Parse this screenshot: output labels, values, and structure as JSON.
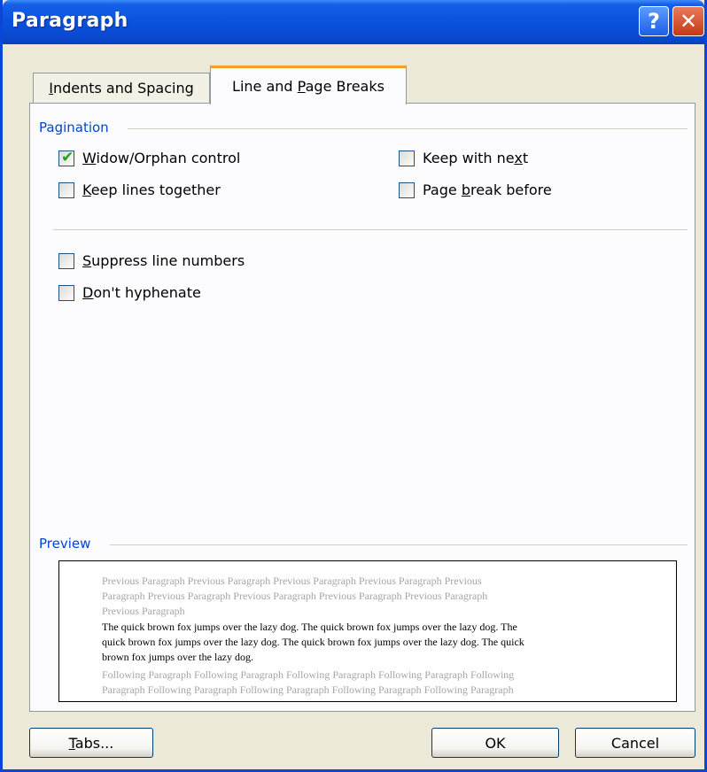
{
  "window": {
    "title": "Paragraph"
  },
  "title_buttons": {
    "help": "?",
    "close": "✕"
  },
  "tabs": [
    {
      "label_pre": "",
      "label_ul": "I",
      "label_post": "ndents and Spacing",
      "active": false
    },
    {
      "label_pre": "Line and ",
      "label_ul": "P",
      "label_post": "age Breaks",
      "active": true
    }
  ],
  "pagination": {
    "label": "Pagination",
    "options": [
      {
        "pre": "",
        "ul": "W",
        "post": "idow/Orphan control",
        "checked": true
      },
      {
        "pre": "",
        "ul": "K",
        "post": "eep lines together",
        "checked": false
      },
      {
        "pre": "Keep with ne",
        "ul": "x",
        "post": "t",
        "checked": false
      },
      {
        "pre": "Page ",
        "ul": "b",
        "post": "reak before",
        "checked": false
      }
    ]
  },
  "other_options": [
    {
      "pre": "",
      "ul": "S",
      "post": "uppress line numbers",
      "checked": false
    },
    {
      "pre": "",
      "ul": "D",
      "post": "on't hyphenate",
      "checked": false
    }
  ],
  "preview": {
    "label": "Preview",
    "previous_lines": [
      "Previous Paragraph Previous Paragraph Previous Paragraph Previous Paragraph Previous",
      "Paragraph Previous Paragraph Previous Paragraph Previous Paragraph Previous Paragraph",
      "Previous Paragraph"
    ],
    "sample_lines": [
      "The quick brown fox jumps over the lazy dog.  The quick brown fox jumps over the lazy dog.  The",
      "quick brown fox jumps over the lazy dog.  The quick brown fox jumps over the lazy dog.  The quick",
      "brown fox jumps over the lazy dog."
    ],
    "following_lines": [
      "Following Paragraph Following Paragraph Following Paragraph Following Paragraph Following",
      "Paragraph Following Paragraph Following Paragraph Following Paragraph Following Paragraph"
    ]
  },
  "buttons": {
    "tabs": {
      "ul": "T",
      "post": "abs..."
    },
    "ok": "OK",
    "cancel": "Cancel"
  },
  "colors": {
    "titlebar": "#0a52dc",
    "group_label": "#0046d5",
    "dialog_bg": "#ece9d8",
    "active_tab_accent": "#f3a12c"
  }
}
